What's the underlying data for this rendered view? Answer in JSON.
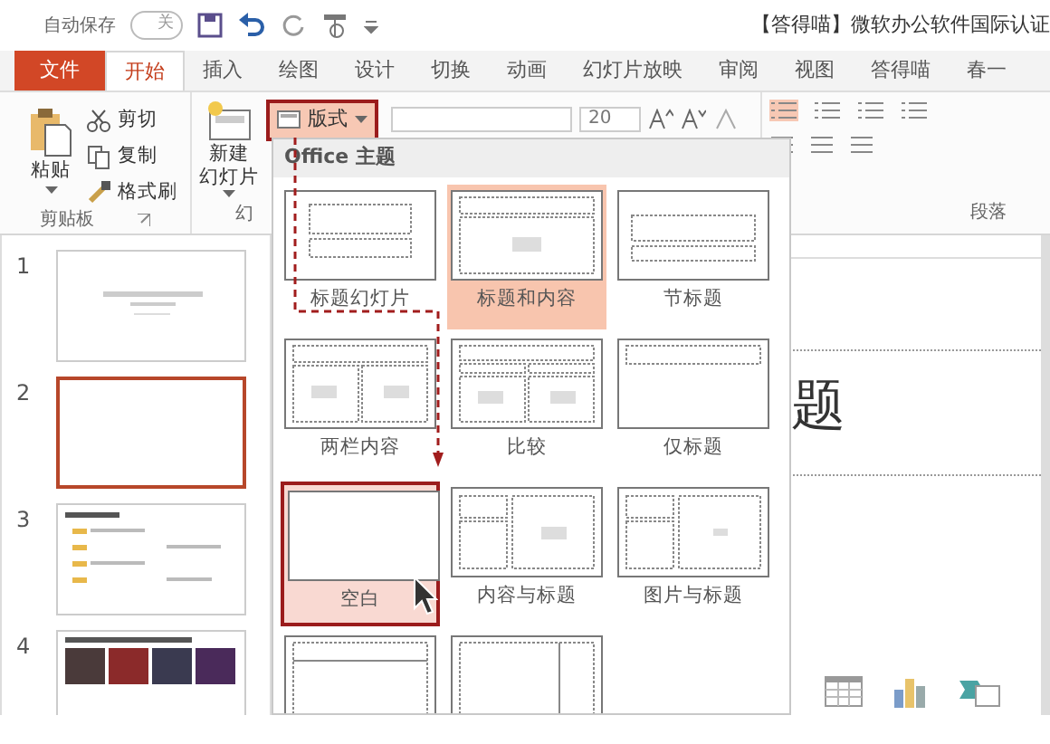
{
  "quick_access": {
    "autosave_label": "自动保存",
    "autosave_toggle": "关",
    "autosave_on": false
  },
  "title": "【答得喵】微软办公软件国际认证",
  "tabs": [
    {
      "label": "文件",
      "kind": "file",
      "selected": false
    },
    {
      "label": "开始",
      "kind": "tab",
      "selected": true
    },
    {
      "label": "插入",
      "kind": "tab",
      "selected": false
    },
    {
      "label": "绘图",
      "kind": "tab",
      "selected": false
    },
    {
      "label": "设计",
      "kind": "tab",
      "selected": false
    },
    {
      "label": "切换",
      "kind": "tab",
      "selected": false
    },
    {
      "label": "动画",
      "kind": "tab",
      "selected": false
    },
    {
      "label": "幻灯片放映",
      "kind": "tab",
      "selected": false
    },
    {
      "label": "审阅",
      "kind": "tab",
      "selected": false
    },
    {
      "label": "视图",
      "kind": "tab",
      "selected": false
    },
    {
      "label": "答得喵",
      "kind": "tab",
      "selected": false
    },
    {
      "label": "春一",
      "kind": "tab",
      "selected": false
    }
  ],
  "ribbon": {
    "clipboard": {
      "paste": "粘贴",
      "cut": "剪切",
      "copy": "复制",
      "format_painter": "格式刷",
      "group_label": "剪贴板"
    },
    "slides_group": {
      "new_slide_line1": "新建",
      "new_slide_line2": "幻灯片",
      "layout_button": "版式",
      "group_label": "幻"
    },
    "font": {
      "size": "20"
    },
    "paragraph": {
      "group_label": "段落"
    }
  },
  "slides": [
    {
      "number": "1",
      "kind": "title",
      "selected": false
    },
    {
      "number": "2",
      "kind": "blank",
      "selected": true
    },
    {
      "number": "3",
      "kind": "list",
      "selected": false
    },
    {
      "number": "4",
      "kind": "pictures",
      "selected": false
    }
  ],
  "layout_gallery": {
    "heading": "Office 主题",
    "layouts": [
      {
        "label": "标题幻灯片",
        "kind": "title",
        "selected": false,
        "hovered": false
      },
      {
        "label": "标题和内容",
        "kind": "title_content",
        "selected": true,
        "hovered": false
      },
      {
        "label": "节标题",
        "kind": "section",
        "selected": false,
        "hovered": false
      },
      {
        "label": "两栏内容",
        "kind": "two_content",
        "selected": false,
        "hovered": false
      },
      {
        "label": "比较",
        "kind": "comparison",
        "selected": false,
        "hovered": false
      },
      {
        "label": "仅标题",
        "kind": "title_only",
        "selected": false,
        "hovered": false
      },
      {
        "label": "空白",
        "kind": "blank",
        "selected": false,
        "hovered": true
      },
      {
        "label": "内容与标题",
        "kind": "content_caption",
        "selected": false,
        "hovered": false
      },
      {
        "label": "图片与标题",
        "kind": "picture_caption",
        "selected": false,
        "hovered": false
      },
      {
        "kind": "title_bar",
        "selected": false,
        "hovered": false
      },
      {
        "kind": "vertical",
        "selected": false,
        "hovered": false
      }
    ]
  },
  "slide_canvas": {
    "title_fragment": "题"
  }
}
